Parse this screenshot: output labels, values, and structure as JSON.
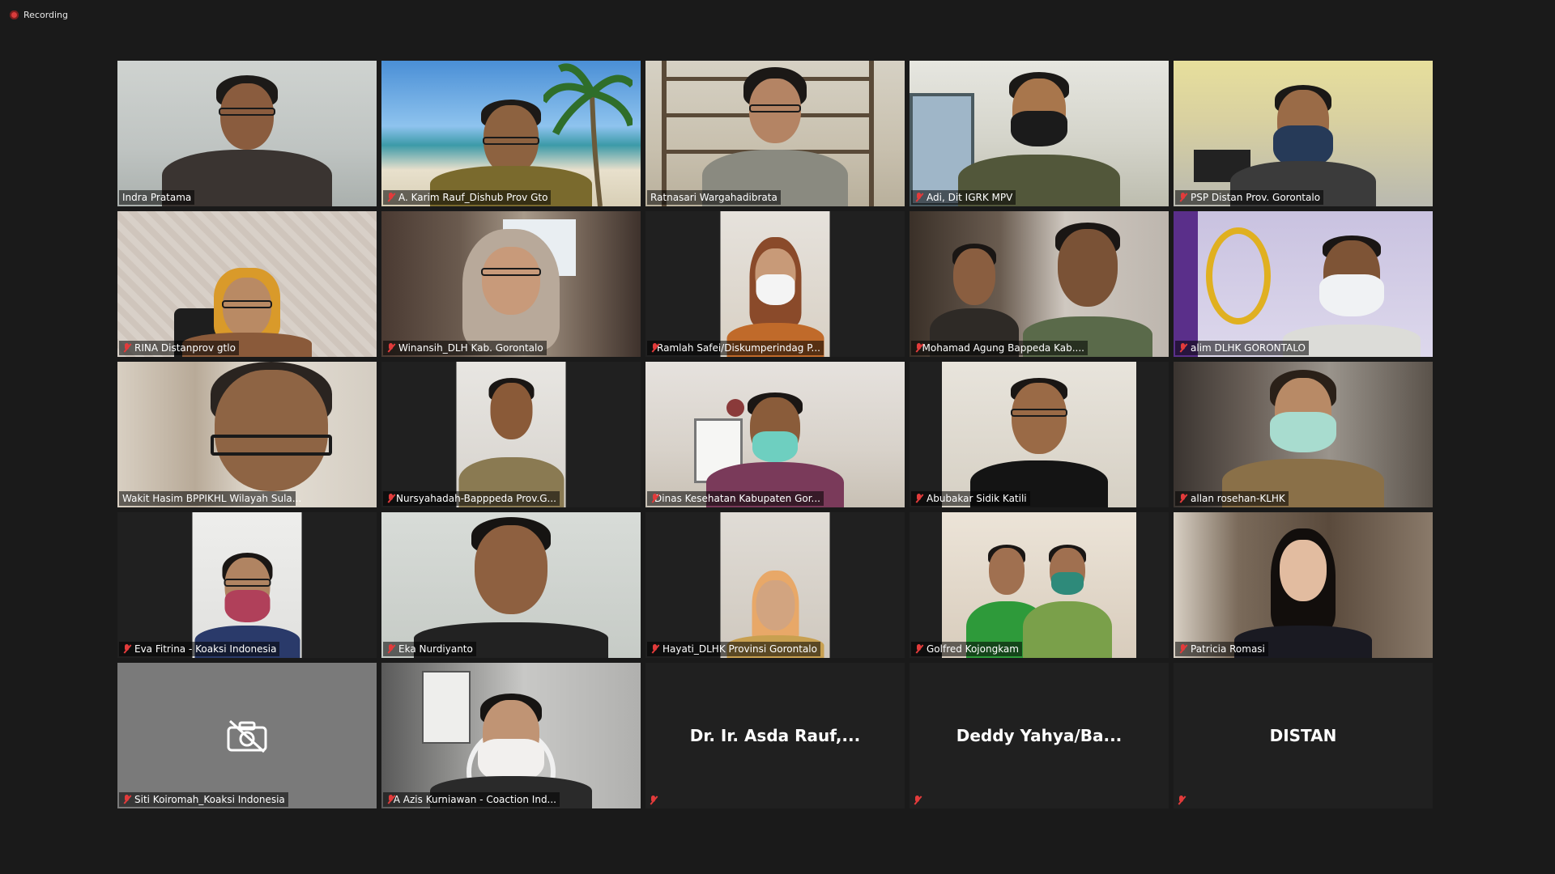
{
  "recording_label": "Recording",
  "participants": [
    {
      "name": "Indra Pratama",
      "muted": false
    },
    {
      "name": "A. Karim Rauf_Dishub Prov Gto",
      "muted": true
    },
    {
      "name": "Ratnasari Wargahadibrata",
      "muted": false
    },
    {
      "name": "Adi, Dit IGRK MPV",
      "muted": true
    },
    {
      "name": "PSP Distan Prov. Gorontalo",
      "muted": true
    },
    {
      "name": "RINA Distanprov gtlo",
      "muted": true
    },
    {
      "name": "Winansih_DLH  Kab. Gorontalo",
      "muted": true
    },
    {
      "name": "Ramlah Safei/Diskumperindag P...",
      "muted": true
    },
    {
      "name": "Mohamad Agung Bappeda Kab....",
      "muted": true
    },
    {
      "name": "alim DLHK GORONTALO",
      "muted": true
    },
    {
      "name": "Wakit Hasim BPPIKHL Wilayah Sula...",
      "muted": false
    },
    {
      "name": "Nursyahadah-Bapppeda Prov.G...",
      "muted": true
    },
    {
      "name": "Dinas Kesehatan Kabupaten Gor...",
      "muted": true
    },
    {
      "name": "Abubakar Sidik Katili",
      "muted": true
    },
    {
      "name": "allan rosehan-KLHK",
      "muted": true
    },
    {
      "name": "Eva Fitrina - Koaksi Indonesia",
      "muted": true
    },
    {
      "name": "Eka Nurdiyanto",
      "muted": true
    },
    {
      "name": "Hayati_DLHK Provinsi Gorontalo",
      "muted": true
    },
    {
      "name": "Golfred Kojongkam",
      "muted": true
    },
    {
      "name": "Patricia Romasi",
      "muted": true
    },
    {
      "name": "Siti Koiromah_Koaksi Indonesia",
      "muted": true
    },
    {
      "name": "A Azis Kurniawan - Coaction Ind...",
      "muted": true
    },
    {
      "name": "Dr. Ir. Asda Rauf,...",
      "muted": true
    },
    {
      "name": "Deddy  Yahya/Ba...",
      "muted": true
    },
    {
      "name": "DISTAN",
      "muted": true
    }
  ],
  "colors": {
    "active_speaker_border": "#d6e63a",
    "muted_mic": "#e23b3b",
    "background": "#1a1a1a"
  }
}
